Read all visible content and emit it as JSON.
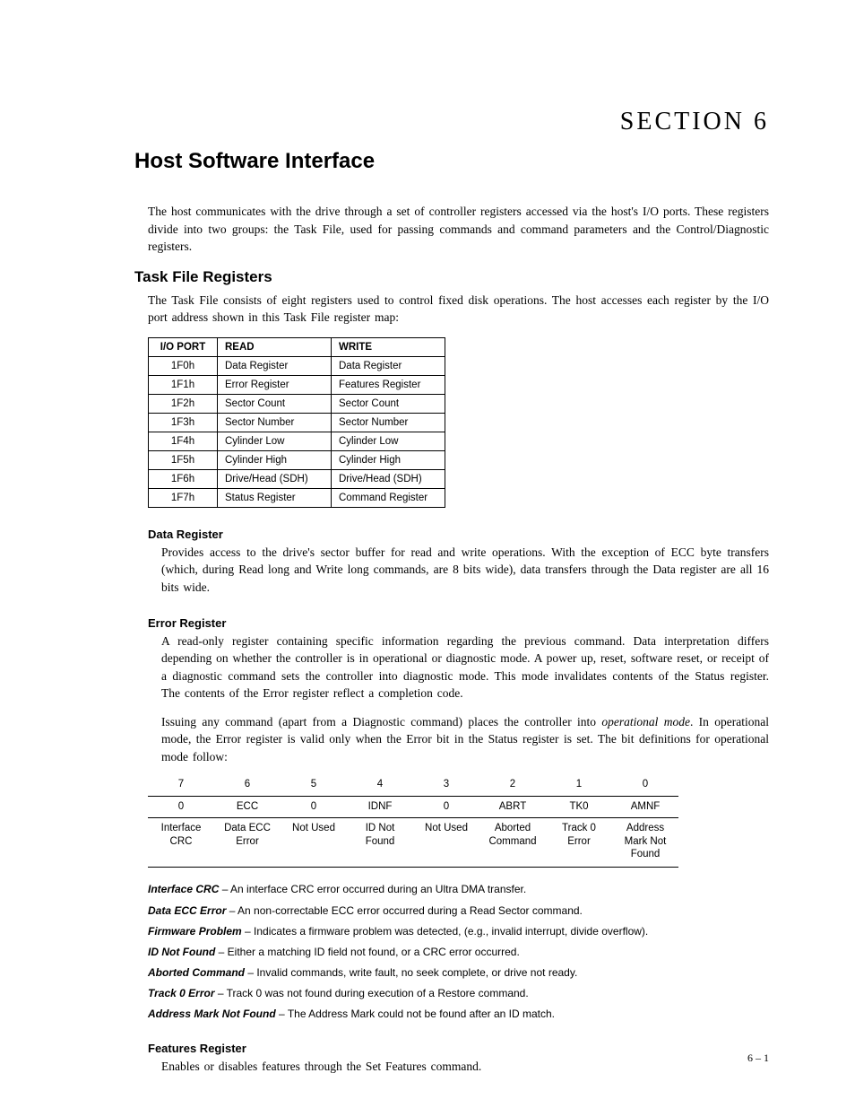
{
  "section_label": "SECTION 6",
  "page_title": "Host Software Interface",
  "intro": "The host communicates with the drive through a set of controller registers accessed via the host's I/O ports. These registers divide into two groups: the Task File, used for passing commands and command parameters and the Control/Diagnostic registers.",
  "tfr_heading": "Task File Registers",
  "tfr_intro": "The Task File consists of eight registers used to control fixed disk operations. The host accesses each register by the I/O port address shown in this Task File register map:",
  "tfr_table": {
    "headers": {
      "port": "I/O PORT",
      "read": "READ",
      "write": "WRITE"
    },
    "rows": [
      {
        "port": "1F0h",
        "read": "Data Register",
        "write": "Data Register"
      },
      {
        "port": "1F1h",
        "read": "Error Register",
        "write": "Features Register"
      },
      {
        "port": "1F2h",
        "read": "Sector Count",
        "write": "Sector Count"
      },
      {
        "port": "1F3h",
        "read": "Sector Number",
        "write": "Sector Number"
      },
      {
        "port": "1F4h",
        "read": "Cylinder Low",
        "write": "Cylinder Low"
      },
      {
        "port": "1F5h",
        "read": "Cylinder High",
        "write": "Cylinder High"
      },
      {
        "port": "1F6h",
        "read": "Drive/Head (SDH)",
        "write": "Drive/Head (SDH)"
      },
      {
        "port": "1F7h",
        "read": "Status Register",
        "write": "Command Register"
      }
    ]
  },
  "data_reg": {
    "heading": "Data Register",
    "text": "Provides access to the drive's sector buffer for read and write operations. With the exception of ECC byte transfers (which, during Read long and Write long commands, are 8 bits wide), data transfers through the Data register are all 16 bits wide."
  },
  "error_reg": {
    "heading": "Error Register",
    "p1": "A read-only register containing specific information regarding the previous command. Data interpretation differs depending on whether the controller is in operational or diagnostic mode. A power up, reset, software reset, or receipt of a diagnostic command sets the controller into diagnostic mode. This mode invalidates contents of the Status register. The contents of the Error register reflect a completion code.",
    "p2_a": "Issuing any command (apart from a Diagnostic command) places the controller into ",
    "p2_i": "operational mode",
    "p2_b": ". In operational mode, the Error register is valid only when the Error bit in the Status register is set. The bit definitions for operational mode follow:",
    "bits_header": [
      "7",
      "6",
      "5",
      "4",
      "3",
      "2",
      "1",
      "0"
    ],
    "bits_code": [
      "0",
      "ECC",
      "0",
      "IDNF",
      "0",
      "ABRT",
      "TK0",
      "AMNF"
    ],
    "bits_desc": [
      "Interface CRC",
      "Data ECC Error",
      "Not Used",
      "ID Not Found",
      "Not Used",
      "Aborted Command",
      "Track 0 Error",
      "Address Mark Not Found"
    ],
    "defs": [
      {
        "term": "Interface CRC",
        "text": " – An interface CRC error occurred during an Ultra DMA transfer."
      },
      {
        "term": "Data ECC Error",
        "text": " – An non-correctable ECC error occurred during a Read Sector command."
      },
      {
        "term": "Firmware Problem",
        "text": " – Indicates a firmware problem was detected, (e.g., invalid interrupt, divide overflow)."
      },
      {
        "term": "ID Not Found",
        "text": " – Either a matching ID field not found, or a CRC error occurred."
      },
      {
        "term": "Aborted Command",
        "text": " – Invalid commands, write fault, no seek complete, or drive not ready."
      },
      {
        "term": "Track 0 Error",
        "text": " – Track 0 was not found during execution of a Restore command."
      },
      {
        "term": "Address Mark Not Found",
        "text": " – The Address Mark could not be found after an ID match."
      }
    ]
  },
  "features_reg": {
    "heading": "Features Register",
    "text": "Enables or disables features through the Set Features command."
  },
  "page_number": "6 – 1"
}
